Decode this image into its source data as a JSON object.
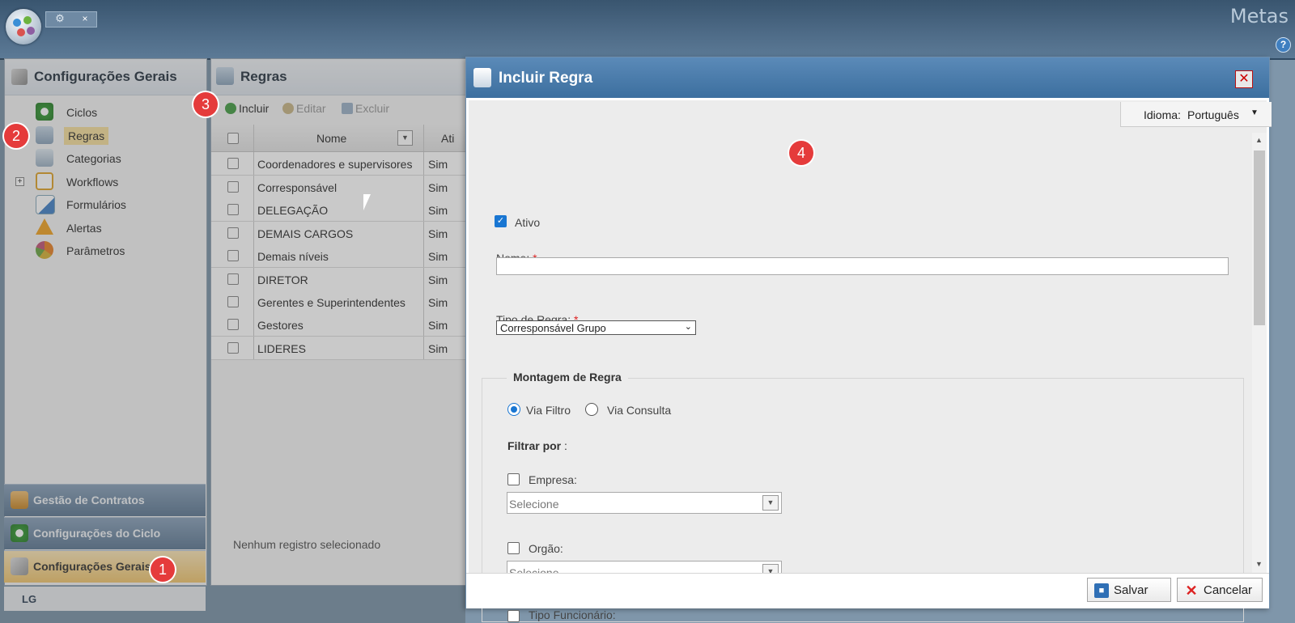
{
  "app": {
    "title": "Metas",
    "tab_close": "×",
    "help": "?"
  },
  "left_panel": {
    "title": "Configurações Gerais",
    "items": [
      {
        "label": "Ciclos",
        "icon": "cycle-icon"
      },
      {
        "label": "Regras",
        "icon": "user-rule-icon",
        "selected": true
      },
      {
        "label": "Categorias",
        "icon": "categories-icon"
      },
      {
        "label": "Workflows",
        "icon": "workflow-icon",
        "expandable": true
      },
      {
        "label": "Formulários",
        "icon": "form-icon"
      },
      {
        "label": "Alertas",
        "icon": "warning-icon"
      },
      {
        "label": "Parâmetros",
        "icon": "parameters-icon"
      }
    ],
    "expander": "+"
  },
  "accordion": {
    "gestao": "Gestão de Contratos",
    "config_ciclo": "Configurações do Ciclo",
    "config_gerais": "Configurações Gerais"
  },
  "logo": "LG",
  "center_panel": {
    "title": "Regras",
    "toolbar": {
      "incluir": "Incluir",
      "editar": "Editar",
      "excluir": "Excluir"
    },
    "grid": {
      "columns": [
        "Nome",
        "Ati"
      ],
      "rows": [
        {
          "nome": "Coordenadores e supervisores",
          "ativo": "Sim"
        },
        {
          "nome": "Corresponsável",
          "ativo": "Sim"
        },
        {
          "nome": "DELEGAÇÃO",
          "ativo": "Sim"
        },
        {
          "nome": "DEMAIS CARGOS",
          "ativo": "Sim"
        },
        {
          "nome": "Demais níveis",
          "ativo": "Sim"
        },
        {
          "nome": "DIRETOR",
          "ativo": "Sim"
        },
        {
          "nome": "Gerentes e Superintendentes",
          "ativo": "Sim"
        },
        {
          "nome": "Gestores",
          "ativo": "Sim"
        },
        {
          "nome": "LIDERES",
          "ativo": "Sim"
        }
      ],
      "empty_msg": "Nenhum registro selecionado"
    }
  },
  "badges": [
    "1",
    "2",
    "3",
    "4"
  ],
  "dialog": {
    "title": "Incluir Regra",
    "close": "✕",
    "idioma_label": "Idioma:",
    "idioma_value": "Português",
    "ativo_label": "Ativo",
    "ativo_checked": true,
    "nome_label": "Nome:",
    "nome_value": "",
    "required_mark": "*",
    "tipo_label": "Tipo de Regra:",
    "tipo_value": "Corresponsável Grupo",
    "montagem_legend": "Montagem de Regra",
    "via_filtro": "Via Filtro",
    "via_consulta": "Via Consulta",
    "filtrar_label": "Filtrar por",
    "filtrar_colon": ":",
    "empresa_label": "Empresa:",
    "orgao_label": "Orgão:",
    "tipo_func_label": "Tipo Funcionário:",
    "select_placeholder": "Selecione",
    "salvar": "Salvar",
    "cancelar": "Cancelar"
  }
}
